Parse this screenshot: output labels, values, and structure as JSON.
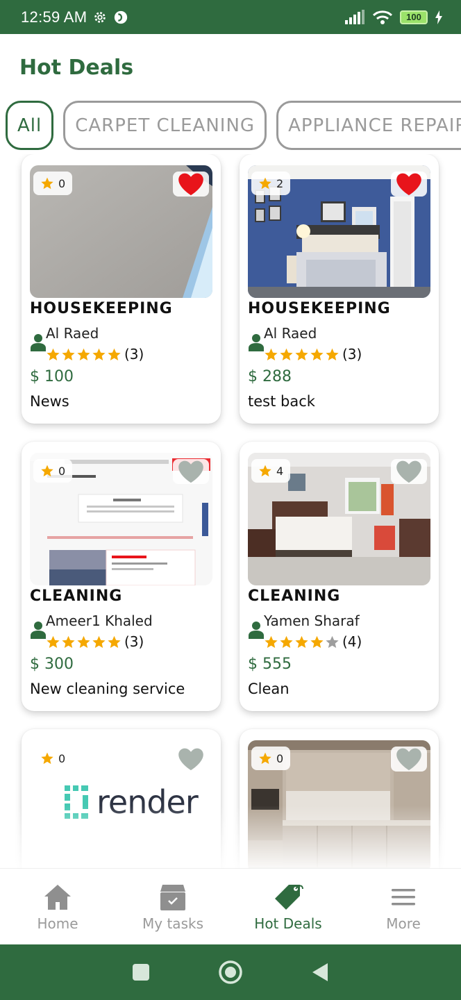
{
  "status_bar": {
    "time": "12:59 AM",
    "battery": "100"
  },
  "header": {
    "title": "Hot Deals"
  },
  "filters": [
    {
      "label": "All",
      "active": true
    },
    {
      "label": "CARPET CLEANING",
      "active": false
    },
    {
      "label": "APPLIANCE REPAIR",
      "active": false
    }
  ],
  "cards": [
    {
      "rating": "0",
      "favorite": true,
      "category": "HOUSEKEEPING",
      "provider": "Al Raed",
      "stars": 5,
      "reviews": "(3)",
      "price": "$ 100",
      "description": "News",
      "image": "grey-surface-photo"
    },
    {
      "rating": "2",
      "favorite": true,
      "category": "HOUSEKEEPING",
      "provider": "Al Raed",
      "stars": 5,
      "reviews": "(3)",
      "price": "$ 288",
      "description": "test back",
      "image": "blue-bedroom-photo"
    },
    {
      "rating": "0",
      "favorite": false,
      "category": "CLEANING",
      "provider": "Ameer1 Khaled",
      "stars": 5,
      "reviews": "(3)",
      "price": "$ 300",
      "description": "New cleaning service",
      "image": "website-screenshot"
    },
    {
      "rating": "4",
      "favorite": false,
      "category": "CLEANING",
      "provider": "Yamen Sharaf",
      "stars": 4,
      "reviews": "(4)",
      "price": "$ 555",
      "description": "Clean",
      "image": "white-bedroom-photo"
    },
    {
      "rating": "0",
      "favorite": false,
      "image": "render-logo",
      "logo_text": "render"
    },
    {
      "rating": "0",
      "favorite": false,
      "image": "kitchen-photo"
    }
  ],
  "bottom_nav": [
    {
      "label": "Home",
      "icon": "home-icon",
      "active": false
    },
    {
      "label": "My tasks",
      "icon": "tasks-box-icon",
      "active": false
    },
    {
      "label": "Hot Deals",
      "icon": "price-tag-icon",
      "active": true
    },
    {
      "label": "More",
      "icon": "menu-icon",
      "active": false
    }
  ],
  "colors": {
    "brand": "#2f6b3f",
    "star": "#f5a800",
    "heart_active": "#e8141b",
    "heart_inactive": "#a9b3ad",
    "muted": "#9a9a9a"
  }
}
